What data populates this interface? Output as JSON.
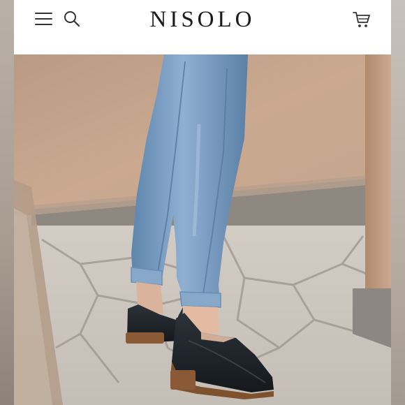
{
  "header": {
    "logo_text": "NISOLO",
    "menu_icon": "hamburger-icon",
    "search_icon": "search-icon",
    "cart_icon": "cart-icon"
  },
  "hero": {
    "description": "product-photo",
    "colors": {
      "wall": "#c9a98e",
      "denim": "#7a9fc4",
      "shoe": "#22272d",
      "stone": "#d6d0c8"
    }
  }
}
